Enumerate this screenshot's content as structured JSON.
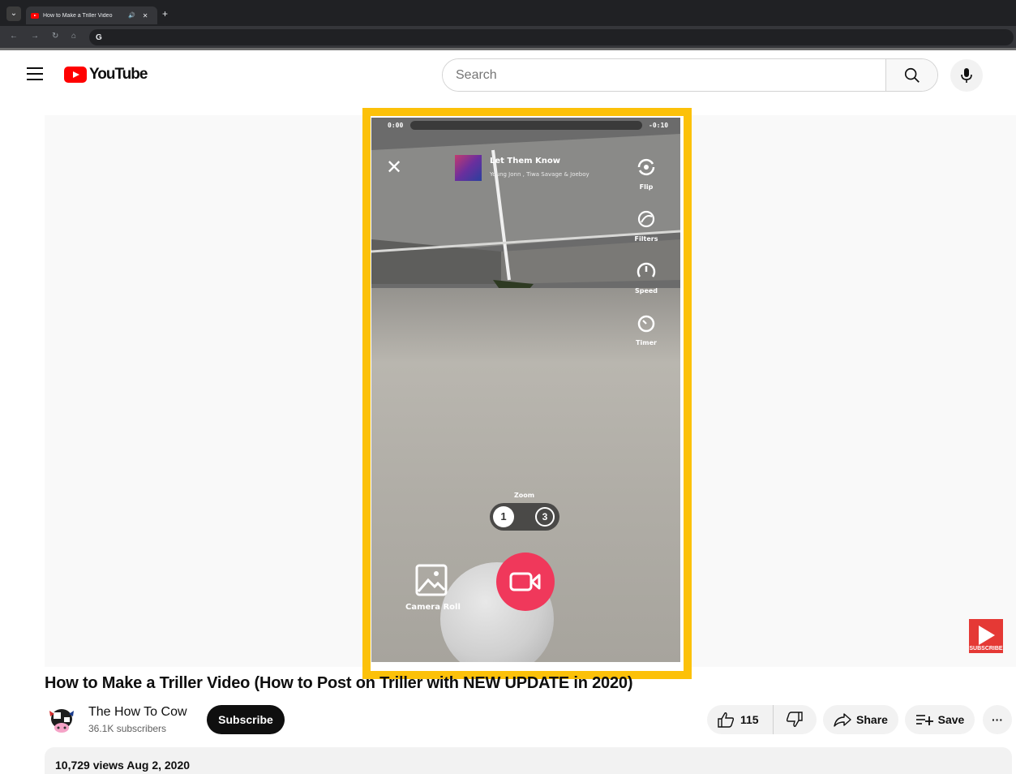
{
  "browser": {
    "tab_title": "How to Make a Triller Video",
    "new_tab": "+",
    "omnibox_glyph": "G"
  },
  "header": {
    "logo_text": "YouTube",
    "search_placeholder": "Search",
    "brand_color": "#ff0000"
  },
  "player": {
    "time_elapsed": "0:00",
    "time_remaining": "-0:10",
    "song_title": "Let Them Know",
    "song_artist": "Young Jonn , Tiwa Savage & Joeboy",
    "tools": [
      {
        "label": "Flip",
        "icon": "flip-camera-icon"
      },
      {
        "label": "Filters",
        "icon": "filters-icon"
      },
      {
        "label": "Speed",
        "icon": "speed-icon"
      },
      {
        "label": "Timer",
        "icon": "timer-icon"
      }
    ],
    "zoom_label": "Zoom",
    "zoom_options": [
      "1",
      "3"
    ],
    "camera_roll_label": "Camera Roll",
    "record_color": "#f0385b",
    "highlight_color": "#fcc109",
    "watermark_text": "SUBSCRIBE"
  },
  "video": {
    "title": "How to Make a Triller Video (How to Post on Triller with NEW UPDATE in 2020)",
    "channel_name": "The How To Cow",
    "subscribers": "36.1K subscribers",
    "subscribe_label": "Subscribe",
    "likes": "115",
    "share_label": "Share",
    "save_label": "Save",
    "more_label": "···",
    "views_date": "10,729 views  Aug 2, 2020"
  }
}
